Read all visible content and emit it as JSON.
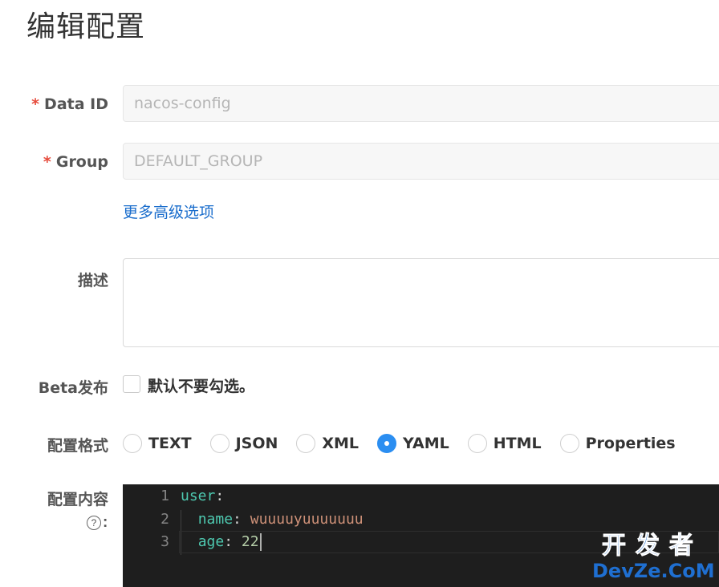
{
  "page": {
    "title": "编辑配置"
  },
  "form": {
    "data_id": {
      "required_mark": "*",
      "label": "Data ID",
      "value": "nacos-config"
    },
    "group": {
      "required_mark": "*",
      "label": "Group",
      "value": "DEFAULT_GROUP"
    },
    "advanced_link": "更多高级选项",
    "description": {
      "label": "描述",
      "value": ""
    },
    "beta": {
      "label": "Beta发布",
      "checkbox_label": "默认不要勾选。",
      "checked": false
    },
    "format": {
      "label": "配置格式",
      "options": [
        "TEXT",
        "JSON",
        "XML",
        "YAML",
        "HTML",
        "Properties"
      ],
      "selected": "YAML"
    },
    "content": {
      "label": "配置内容",
      "help_icon": "?",
      "colon": ":",
      "lines": [
        {
          "num": "1",
          "key": "user",
          "sep": ":",
          "value": ""
        },
        {
          "num": "2",
          "key": "name",
          "sep": ": ",
          "value": "wuuuuyuuuuuuu"
        },
        {
          "num": "3",
          "key": "age",
          "sep": ": ",
          "value": "22"
        }
      ]
    }
  },
  "watermark": {
    "line1": "开发者",
    "line2": "DevZe.CoM"
  },
  "colors": {
    "accent": "#2b8ef1",
    "link": "#1a6dcc",
    "required": "#e64a3b",
    "editor_bg": "#1e1e1e"
  }
}
